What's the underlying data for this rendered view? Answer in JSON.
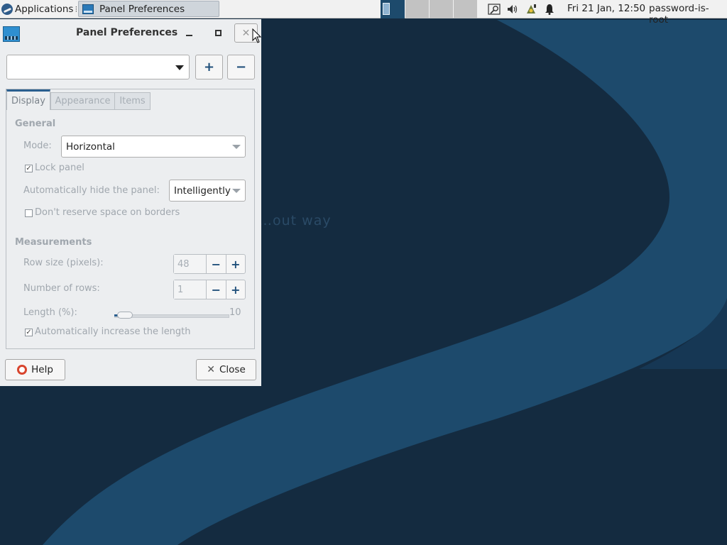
{
  "top_panel": {
    "applications_label": "Applications",
    "applications_separator": "⁝",
    "taskbar_title": "Panel Preferences",
    "clock": "Fri 21 Jan, 12:50",
    "user": "password-is-root",
    "tray_icons": [
      "search-icon",
      "volume-icon",
      "network-icon",
      "notification-bell-icon"
    ]
  },
  "desktop": {
    "wallpaper_text": "…out way"
  },
  "dialog": {
    "title": "Panel Preferences",
    "close_glyph": "✕",
    "panel_selector_value": "",
    "add_glyph": "+",
    "remove_glyph": "−",
    "tabs": [
      {
        "label": "Display",
        "active": true
      },
      {
        "label": "Appearance",
        "active": false
      },
      {
        "label": "Items",
        "active": false
      }
    ],
    "general": {
      "heading": "General",
      "mode_label": "Mode:",
      "mode_value": "Horizontal",
      "lock_panel_label": "Lock panel",
      "lock_panel_checked": true,
      "autohide_label": "Automatically hide the panel:",
      "autohide_value": "Intelligently",
      "dont_reserve_label": "Don't reserve space on borders",
      "dont_reserve_checked": false
    },
    "measurements": {
      "heading": "Measurements",
      "row_size_label": "Row size (pixels):",
      "row_size_value": "48",
      "rows_label": "Number of rows:",
      "rows_value": "1",
      "length_label": "Length (%):",
      "length_value": "10",
      "length_fraction": 0.1,
      "auto_length_label": "Automatically increase the length",
      "auto_length_checked": true
    },
    "help_label": "Help",
    "close_label": "Close"
  },
  "colors": {
    "accent": "#2a5f8f",
    "wallpaper_dark": "#142b40",
    "wallpaper_band": "#1d4a6c"
  }
}
